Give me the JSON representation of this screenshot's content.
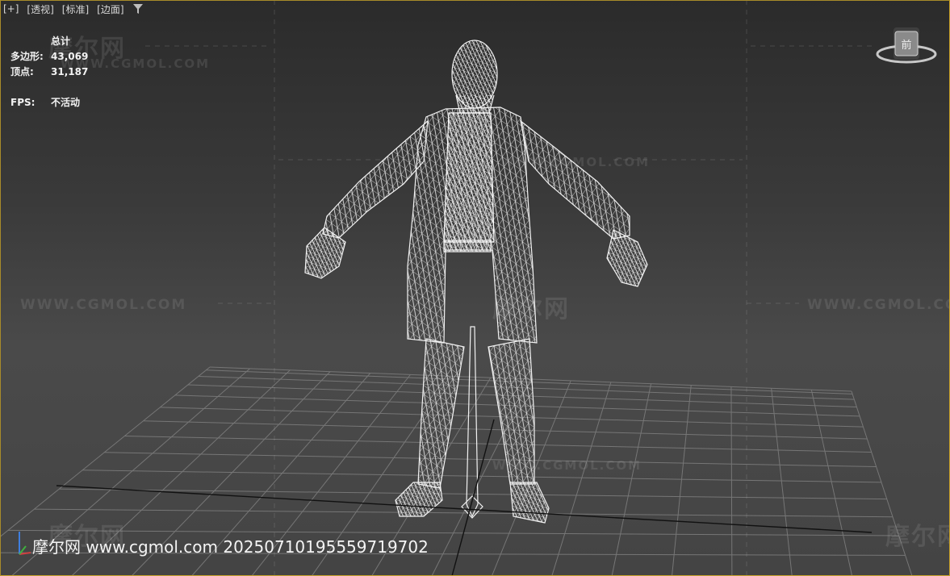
{
  "viewport": {
    "menu": [
      "[+]",
      "[透视]",
      "[标准]",
      "[边面]"
    ],
    "filter_icon": "filter-icon"
  },
  "stats": {
    "header": "总计",
    "polygons_label": "多边形:",
    "polygons_value": "43,069",
    "vertices_label": "顶点:",
    "vertices_value": "31,187",
    "fps_label": "FPS:",
    "fps_value": "不活动"
  },
  "watermark": {
    "logo_text": "摩尔网",
    "url_text": "WWW.CGMOL.COM"
  },
  "footer": {
    "text": "摩尔网 www.cgmol.com 20250710195559719702"
  },
  "viewcube": {
    "face_label": "前"
  },
  "colors": {
    "border": "#c8a22a",
    "wire": "#f0f0f0",
    "grid": "#7a7a7a"
  }
}
